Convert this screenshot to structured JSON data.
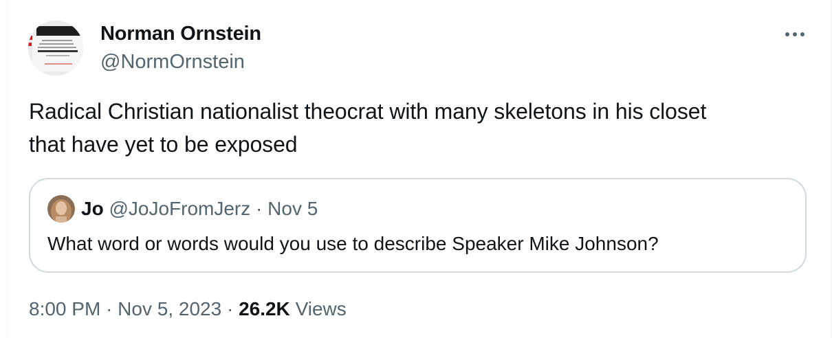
{
  "tweet": {
    "author": {
      "name": "Norman Ornstein",
      "handle": "@NormOrnstein",
      "avatar_icon": "book-cover-avatar"
    },
    "more_icon": "more-horizontal-icon",
    "text_line1": "Radical Christian nationalist theocrat with many skeletons in his closet",
    "text_line2": "that have yet to be exposed",
    "quote": {
      "name": "Jo",
      "handle": "@JoJoFromJerz",
      "separator": "·",
      "date": "Nov 5",
      "text": "What word or words would you use to describe Speaker Mike Johnson?",
      "avatar_icon": "profile-photo-avatar"
    },
    "meta": {
      "time": "8:00 PM",
      "separator": "·",
      "date": "Nov 5, 2023",
      "views_count": "26.2K",
      "views_label": "Views"
    }
  },
  "colors": {
    "text_primary": "#0f1419",
    "text_secondary": "#536471",
    "border": "#cfd9de"
  }
}
